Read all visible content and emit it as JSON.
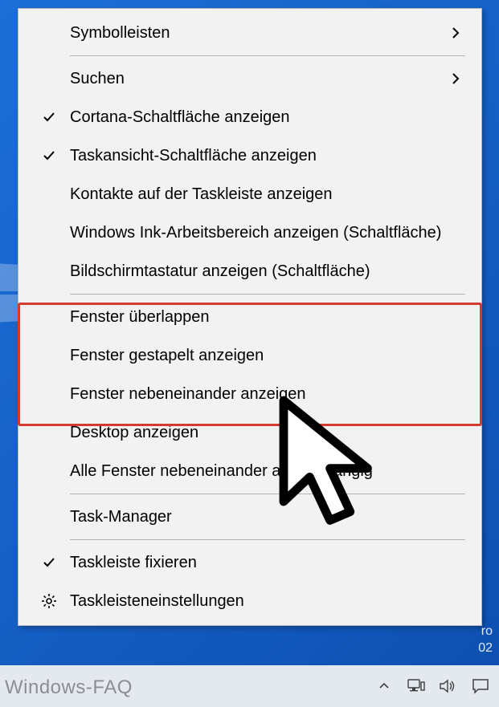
{
  "menu": {
    "items": [
      {
        "label": "Symbolleisten",
        "submenu": true
      },
      {
        "sep": true
      },
      {
        "label": "Suchen",
        "submenu": true
      },
      {
        "label": "Cortana-Schaltfläche anzeigen",
        "checked": true
      },
      {
        "label": "Taskansicht-Schaltfläche anzeigen",
        "checked": true
      },
      {
        "label": "Kontakte auf der Taskleiste anzeigen"
      },
      {
        "label": "Windows Ink-Arbeitsbereich anzeigen (Schaltfläche)"
      },
      {
        "label": "Bildschirmtastatur anzeigen (Schaltfläche)"
      },
      {
        "sep": true
      },
      {
        "label": "Fenster überlappen"
      },
      {
        "label": "Fenster gestapelt anzeigen"
      },
      {
        "label": "Fenster nebeneinander anzeigen"
      },
      {
        "label": "Desktop anzeigen"
      },
      {
        "label": "Alle Fenster nebeneinander an rückgängig"
      },
      {
        "sep": true
      },
      {
        "label": "Task-Manager"
      },
      {
        "sep": true
      },
      {
        "label": "Taskleiste fixieren",
        "checked": true
      },
      {
        "label": "Taskleisteneinstellungen",
        "iconType": "gear"
      }
    ]
  },
  "highlight": {
    "color": "#d43a2e"
  },
  "os_hint": {
    "line1": "ro",
    "line2": "02"
  },
  "watermark": "Windows-FAQ"
}
